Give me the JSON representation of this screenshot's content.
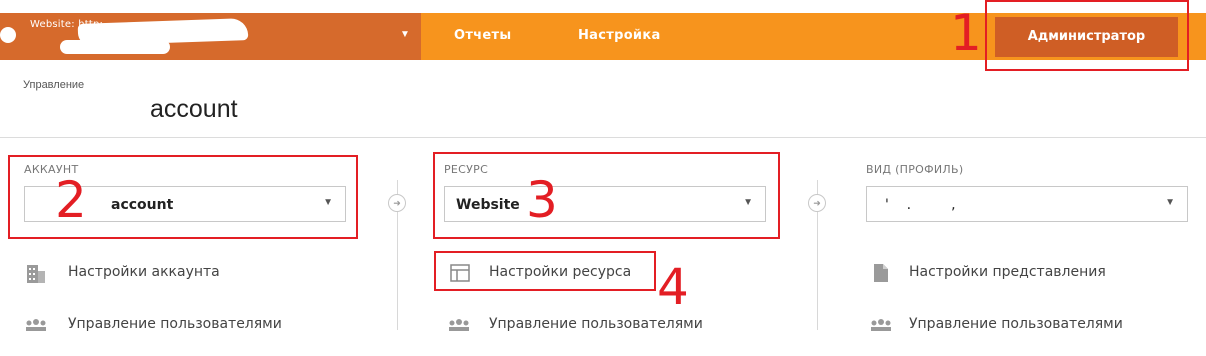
{
  "topbar": {
    "site_label": "Website: http:",
    "nav": {
      "reports": "Отчеты",
      "settings": "Настройка",
      "admin": "Администратор"
    }
  },
  "management": {
    "label": "Управление",
    "title": "account"
  },
  "columns": {
    "account": {
      "label": "АККАУНТ",
      "selected": "account",
      "items": [
        "Настройки аккаунта",
        "Управление пользователями"
      ]
    },
    "property": {
      "label": "РЕСУРС",
      "selected": "Website",
      "items": [
        "Настройки ресурса",
        "Управление пользователями"
      ]
    },
    "view": {
      "label": "ВИД (ПРОФИЛЬ)",
      "selected": "'    .         ,",
      "items": [
        "Настройки представления",
        "Управление пользователями"
      ]
    }
  },
  "annotations": [
    "1",
    "2",
    "3",
    "4"
  ],
  "colors": {
    "topbar": "#f7941d",
    "site_bar": "#d66a2c",
    "admin_tab": "#cf5e25",
    "annotation": "#e31e24"
  }
}
